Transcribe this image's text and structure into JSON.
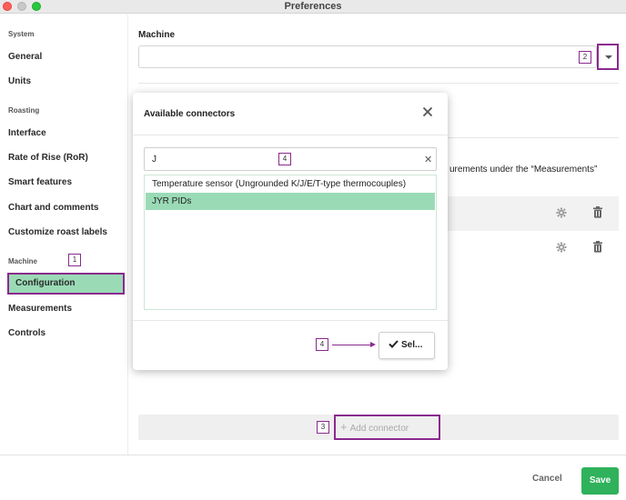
{
  "window": {
    "title": "Preferences"
  },
  "sidebar": {
    "sections": [
      {
        "label": "System",
        "items": [
          {
            "label": "General"
          },
          {
            "label": "Units"
          }
        ]
      },
      {
        "label": "Roasting",
        "items": [
          {
            "label": "Interface"
          },
          {
            "label": "Rate of Rise (RoR)"
          },
          {
            "label": "Smart features"
          },
          {
            "label": "Chart and comments"
          },
          {
            "label": "Customize roast labels"
          }
        ]
      },
      {
        "label": "Machine",
        "items": [
          {
            "label": "Configuration",
            "active": true
          },
          {
            "label": "Measurements"
          },
          {
            "label": "Controls"
          }
        ]
      }
    ]
  },
  "main": {
    "machine_label": "Machine",
    "machine_value": "",
    "background_text": "urements under the “Measurements”",
    "add_connector_label": "Add connector"
  },
  "annotations": {
    "a1": "1",
    "a2": "2",
    "a3": "3",
    "a4_search": "4",
    "a4_select": "4"
  },
  "modal": {
    "title": "Available connectors",
    "search_value": "J",
    "options": [
      {
        "label": "Temperature sensor (Ungrounded K/J/E/T-type thermocouples)",
        "selected": false
      },
      {
        "label": "JYR PIDs",
        "selected": true
      }
    ],
    "select_label": "Sel..."
  },
  "footer": {
    "cancel_label": "Cancel",
    "save_label": "Save"
  },
  "colors": {
    "accent": "#2fb25b",
    "selection": "#9adbb6",
    "annotation": "#8a2a8e"
  },
  "icons": {
    "close": "close-icon",
    "clear": "clear-icon",
    "check": "check-icon",
    "gear": "gear-icon",
    "trash": "trash-icon",
    "plus": "plus-icon",
    "caret": "chevron-down-icon"
  }
}
